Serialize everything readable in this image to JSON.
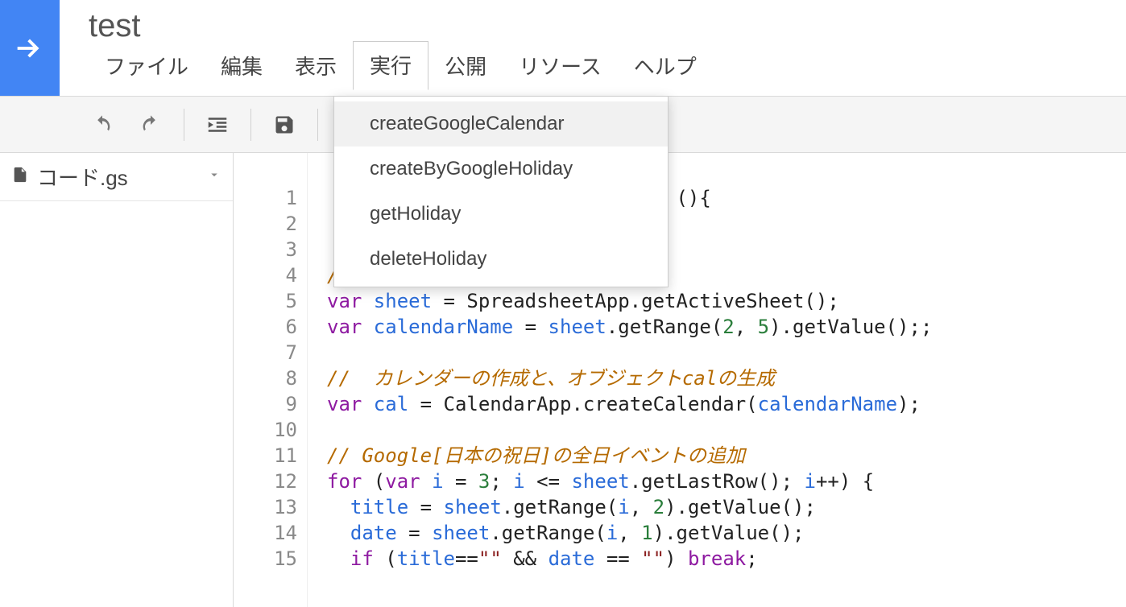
{
  "project": {
    "title": "test"
  },
  "menubar": {
    "items": [
      {
        "label": "ファイル"
      },
      {
        "label": "編集"
      },
      {
        "label": "表示"
      },
      {
        "label": "実行",
        "open": true
      },
      {
        "label": "公開"
      },
      {
        "label": "リソース"
      },
      {
        "label": "ヘルプ"
      }
    ]
  },
  "run_menu": {
    "items": [
      {
        "label": "createGoogleCalendar",
        "highlight": true
      },
      {
        "label": "createByGoogleHoliday"
      },
      {
        "label": "getHoliday"
      },
      {
        "label": "deleteHoliday"
      }
    ]
  },
  "toolbar": {
    "undo": "undo",
    "redo": "redo",
    "indent": "indent",
    "save": "save",
    "run": "run"
  },
  "sidebar": {
    "file_name": "コード.gs"
  },
  "editor": {
    "line_numbers": [
      "1",
      "2",
      "3",
      "4",
      "5",
      "6",
      "7",
      "8",
      "9",
      "10",
      "11",
      "12",
      "13",
      "14",
      "15"
    ],
    "lines": [
      {
        "tokens": [
          {
            "c": "pn",
            "t": "                              (){"
          }
        ]
      },
      {
        "tokens": [
          {
            "c": "pn",
            "t": " "
          }
        ]
      },
      {
        "tokens": [
          {
            "c": "pn",
            "t": " "
          }
        ]
      },
      {
        "tokens": [
          {
            "c": "cm",
            "t": "//  カレンダー名の取得"
          }
        ]
      },
      {
        "tokens": [
          {
            "c": "kw",
            "t": "var "
          },
          {
            "c": "id",
            "t": "sheet"
          },
          {
            "c": "pn",
            "t": " = SpreadsheetApp.getActiveSheet();"
          }
        ]
      },
      {
        "tokens": [
          {
            "c": "kw",
            "t": "var "
          },
          {
            "c": "id",
            "t": "calendarName"
          },
          {
            "c": "pn",
            "t": " = "
          },
          {
            "c": "id",
            "t": "sheet"
          },
          {
            "c": "pn",
            "t": ".getRange("
          },
          {
            "c": "num",
            "t": "2"
          },
          {
            "c": "pn",
            "t": ", "
          },
          {
            "c": "num",
            "t": "5"
          },
          {
            "c": "pn",
            "t": ").getValue();;"
          }
        ]
      },
      {
        "tokens": [
          {
            "c": "pn",
            "t": " "
          }
        ]
      },
      {
        "tokens": [
          {
            "c": "cm",
            "t": "//  カレンダーの作成と、オブジェクトcalの生成"
          }
        ]
      },
      {
        "tokens": [
          {
            "c": "kw",
            "t": "var "
          },
          {
            "c": "id",
            "t": "cal"
          },
          {
            "c": "pn",
            "t": " = CalendarApp.createCalendar("
          },
          {
            "c": "id",
            "t": "calendarName"
          },
          {
            "c": "pn",
            "t": ");"
          }
        ]
      },
      {
        "tokens": [
          {
            "c": "pn",
            "t": " "
          }
        ]
      },
      {
        "tokens": [
          {
            "c": "cm",
            "t": "// Google[日本の祝日]の全日イベントの追加"
          }
        ]
      },
      {
        "tokens": [
          {
            "c": "kw",
            "t": "for"
          },
          {
            "c": "pn",
            "t": " ("
          },
          {
            "c": "kw",
            "t": "var "
          },
          {
            "c": "id",
            "t": "i"
          },
          {
            "c": "pn",
            "t": " = "
          },
          {
            "c": "num",
            "t": "3"
          },
          {
            "c": "pn",
            "t": "; "
          },
          {
            "c": "id",
            "t": "i"
          },
          {
            "c": "pn",
            "t": " <= "
          },
          {
            "c": "id",
            "t": "sheet"
          },
          {
            "c": "pn",
            "t": ".getLastRow(); "
          },
          {
            "c": "id",
            "t": "i"
          },
          {
            "c": "pn",
            "t": "++) {"
          }
        ]
      },
      {
        "tokens": [
          {
            "c": "pn",
            "t": "  "
          },
          {
            "c": "id",
            "t": "title"
          },
          {
            "c": "pn",
            "t": " = "
          },
          {
            "c": "id",
            "t": "sheet"
          },
          {
            "c": "pn",
            "t": ".getRange("
          },
          {
            "c": "id",
            "t": "i"
          },
          {
            "c": "pn",
            "t": ", "
          },
          {
            "c": "num",
            "t": "2"
          },
          {
            "c": "pn",
            "t": ").getValue();"
          }
        ]
      },
      {
        "tokens": [
          {
            "c": "pn",
            "t": "  "
          },
          {
            "c": "id",
            "t": "date"
          },
          {
            "c": "pn",
            "t": " = "
          },
          {
            "c": "id",
            "t": "sheet"
          },
          {
            "c": "pn",
            "t": ".getRange("
          },
          {
            "c": "id",
            "t": "i"
          },
          {
            "c": "pn",
            "t": ", "
          },
          {
            "c": "num",
            "t": "1"
          },
          {
            "c": "pn",
            "t": ").getValue();"
          }
        ]
      },
      {
        "tokens": [
          {
            "c": "pn",
            "t": "  "
          },
          {
            "c": "kw",
            "t": "if"
          },
          {
            "c": "pn",
            "t": " ("
          },
          {
            "c": "id",
            "t": "title"
          },
          {
            "c": "pn",
            "t": "=="
          },
          {
            "c": "str",
            "t": "\"\""
          },
          {
            "c": "pn",
            "t": " && "
          },
          {
            "c": "id",
            "t": "date"
          },
          {
            "c": "pn",
            "t": " == "
          },
          {
            "c": "str",
            "t": "\"\""
          },
          {
            "c": "pn",
            "t": ") "
          },
          {
            "c": "kw",
            "t": "break"
          },
          {
            "c": "pn",
            "t": ";"
          }
        ]
      }
    ]
  }
}
